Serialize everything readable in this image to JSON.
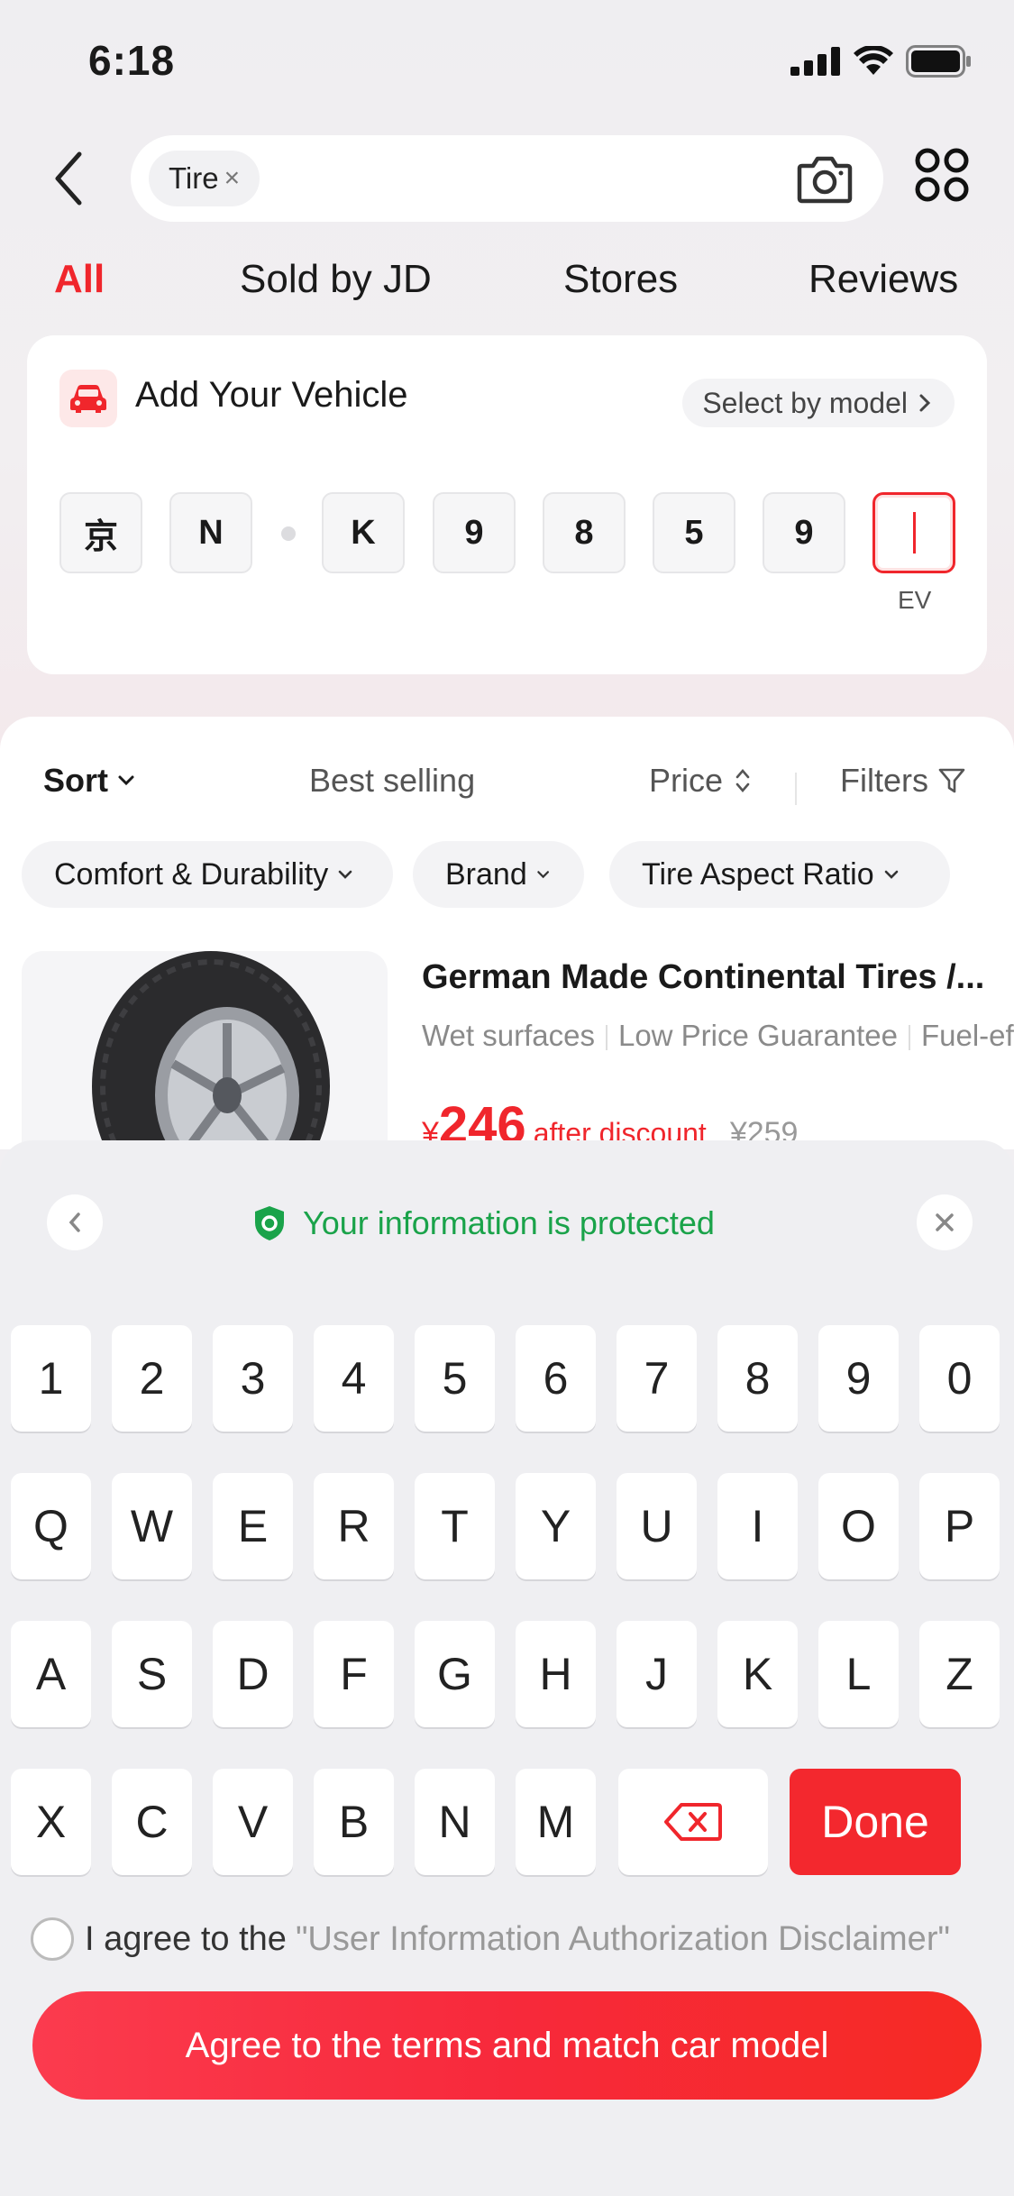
{
  "status_bar": {
    "time": "6:18"
  },
  "search": {
    "tag": "Tire",
    "tag_remove": "×"
  },
  "tabs": [
    {
      "label": "All",
      "active": true
    },
    {
      "label": "Sold by JD",
      "active": false
    },
    {
      "label": "Stores",
      "active": false
    },
    {
      "label": "Reviews",
      "active": false
    }
  ],
  "vehicle": {
    "title": "Add Your Vehicle",
    "select_by_model": "Select by model",
    "plate_chars": [
      "京",
      "N",
      "K",
      "9",
      "8",
      "5",
      "9",
      ""
    ],
    "ev_label": "EV"
  },
  "sort_bar": {
    "sort": "Sort",
    "best_selling": "Best selling",
    "price": "Price",
    "filters": "Filters"
  },
  "filter_chips": [
    "Comfort & Durability",
    "Brand",
    "Tire Aspect Ratio"
  ],
  "product": {
    "title": "German Made Continental Tires /...",
    "tags": [
      "Wet surfaces",
      "Low Price Guarantee",
      "Fuel-efficient"
    ],
    "currency": "¥",
    "price": "246",
    "after_discount": "after discount",
    "original_price": "¥259"
  },
  "keyboard": {
    "protected_text": "Your information is protected",
    "rows": [
      [
        "1",
        "2",
        "3",
        "4",
        "5",
        "6",
        "7",
        "8",
        "9",
        "0"
      ],
      [
        "Q",
        "W",
        "E",
        "R",
        "T",
        "Y",
        "U",
        "I",
        "O",
        "P"
      ],
      [
        "A",
        "S",
        "D",
        "F",
        "G",
        "H",
        "J",
        "K",
        "L",
        "Z"
      ],
      [
        "X",
        "C",
        "V",
        "B",
        "N",
        "M"
      ]
    ],
    "done_label": "Done"
  },
  "agreement": {
    "prefix": "I agree to the",
    "link": "\"User Information Authorization Disclaimer\""
  },
  "cta": {
    "label": "Agree to the terms and match car model"
  },
  "colors": {
    "accent": "#f0262c",
    "protect_green": "#1aa34a"
  }
}
